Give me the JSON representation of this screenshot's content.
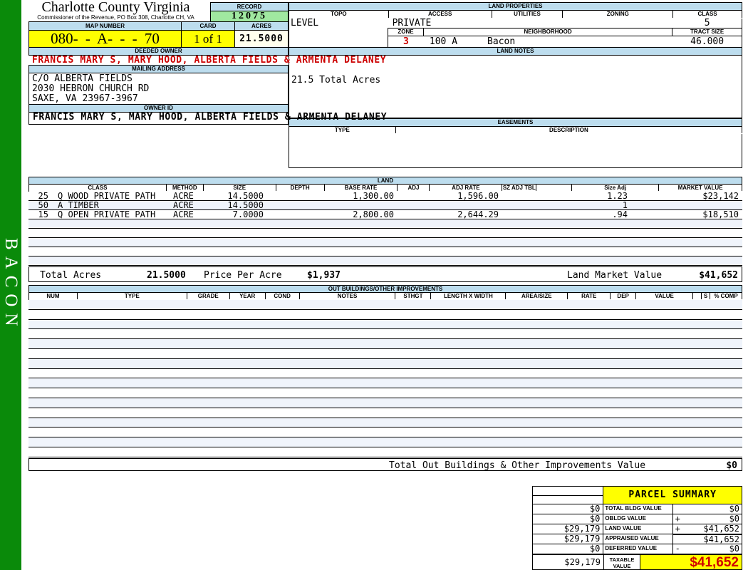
{
  "sidebar": {
    "label": "BACON"
  },
  "header": {
    "county": "Charlotte County Virginia",
    "commissioner": "Commissioner of the Revenue, PO Box 308, Charlotte CH, VA",
    "record_label": "RECORD",
    "record_value": "12075",
    "map_number_label": "MAP NUMBER",
    "map_number": "080- - A- - - 70",
    "card_label": "CARD",
    "card_value": "1 of 1",
    "acres_label": "ACRES",
    "acres_value": "21.5000"
  },
  "owner": {
    "deeded_owner_label": "DEEDED OWNER",
    "deeded_owner": "FRANCIS MARY S, MARY HOOD, ALBERTA FIELDS & ARMENTA DELANEY",
    "mailing_address_label": "MAILING ADDRESS",
    "address_lines": [
      "C/O ALBERTA FIELDS",
      "2030 HEBRON CHURCH RD",
      "SAXE, VA 23967-3967"
    ],
    "owner_id_label": "OWNER ID",
    "owner_id": "FRANCIS MARY S, MARY HOOD, ALBERTA FIELDS & ARMENTA DELANEY"
  },
  "land_properties": {
    "title": "LAND PROPERTIES",
    "topo_label": "TOPO",
    "access_label": "ACCESS",
    "utilities_label": "UTILITIES",
    "zoning_label": "ZONING",
    "class_label": "CLASS",
    "topo": "LEVEL",
    "access": "PRIVATE",
    "utilities": "",
    "zoning": "",
    "class": "5",
    "zone_label": "ZONE",
    "zone": "3",
    "neighborhood_label": "NEIGHBORHOOD",
    "neighborhood_code": "100 A",
    "neighborhood_name": "Bacon",
    "tract_size_label": "TRACT SIZE",
    "tract_size": "46.000"
  },
  "land_notes": {
    "title": "LAND NOTES",
    "note": "21.5 Total Acres"
  },
  "easements": {
    "title": "EASEMENTS",
    "type_label": "TYPE",
    "description_label": "DESCRIPTION"
  },
  "land": {
    "title": "LAND",
    "columns": [
      "CLASS",
      "METHOD",
      "SIZE",
      "DEPTH",
      "BASE RATE",
      "ADJ",
      "ADJ RATE",
      "SZ ADJ TBL",
      "",
      "Size Adj",
      "MARKET VALUE"
    ],
    "rows": [
      {
        "num": "25",
        "class": "Q WOOD PRIVATE PATH",
        "method": "ACRE",
        "size": "14.5000",
        "depth": "",
        "base_rate": "1,300.00",
        "adj": "",
        "adj_rate": "1,596.00",
        "sz_adj_tbl": "",
        "size_adj": "1.23",
        "market_value": "$23,142"
      },
      {
        "num": "50",
        "class": "A TIMBER",
        "method": "ACRE",
        "size": "14.5000",
        "depth": "",
        "base_rate": "",
        "adj": "",
        "adj_rate": "",
        "sz_adj_tbl": "",
        "size_adj": "1",
        "market_value": ""
      },
      {
        "num": "15",
        "class": "Q OPEN PRIVATE PATH",
        "method": "ACRE",
        "size": "7.0000",
        "depth": "",
        "base_rate": "2,800.00",
        "adj": "",
        "adj_rate": "2,644.29",
        "sz_adj_tbl": "",
        "size_adj": ".94",
        "market_value": "$18,510"
      }
    ],
    "totals": {
      "total_acres_label": "Total Acres",
      "total_acres": "21.5000",
      "price_per_acre_label": "Price Per Acre",
      "price_per_acre": "$1,937",
      "land_market_value_label": "Land Market Value",
      "land_market_value": "$41,652"
    }
  },
  "out_buildings": {
    "title": "OUT BUILDINGS/OTHER IMPROVEMENTS",
    "columns": [
      "NUM",
      "TYPE",
      "GRADE",
      "YEAR",
      "COND",
      "NOTES",
      "STHGT",
      "LENGTH X WIDTH",
      "AREA/SIZE",
      "RATE",
      "DEP",
      "VALUE",
      "",
      "S",
      "% COMP"
    ],
    "total_label": "Total Out Buildings & Other Improvements Value",
    "total_value": "$0"
  },
  "parcel_summary": {
    "title": "PARCEL SUMMARY",
    "rows": [
      {
        "left": "$0",
        "label": "TOTAL BLDG VALUE",
        "op": "",
        "value": "$0"
      },
      {
        "left": "$0",
        "label": "OBLDG VALUE",
        "op": "+",
        "value": "$0"
      },
      {
        "left": "$29,179",
        "label": "LAND VALUE",
        "op": "+",
        "value": "$41,652"
      },
      {
        "left": "$29,179",
        "label": "APPRAISED VALUE",
        "op": "",
        "value": "$41,652"
      },
      {
        "left": "$0",
        "label": "DEFERRED VALUE",
        "op": "-",
        "value": "$0"
      }
    ],
    "taxable": {
      "left": "$29,179",
      "label": "TAXABLE VALUE",
      "value": "$41,652"
    }
  },
  "colors": {
    "sidebar_green": "#0a8a0a",
    "header_blue": "#bdddee",
    "highlight_yellow": "#ffff00",
    "record_green": "#a0e8a0",
    "acres_ivory": "#ffffee",
    "alert_red": "#cc0000",
    "stripe_blue": "#f0f4fb"
  }
}
